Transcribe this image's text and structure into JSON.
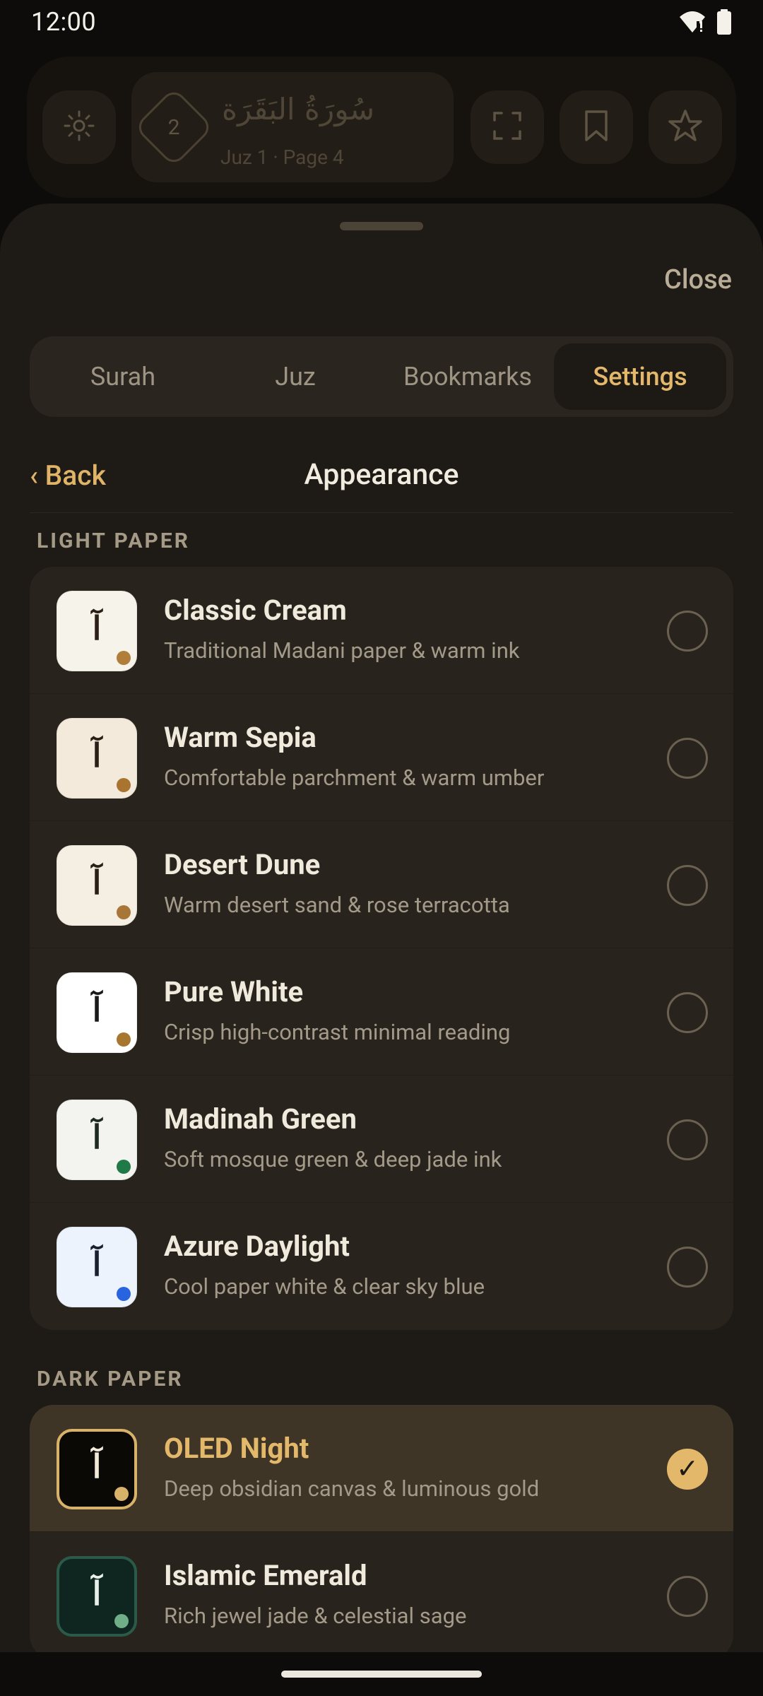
{
  "status_bar": {
    "time": "12:00"
  },
  "reader": {
    "surah_number": "2",
    "surah_name_arabic": "سُورَةُ البَقَرَة",
    "location": "Juz 1 · Page 4"
  },
  "sheet": {
    "close_label": "Close",
    "tabs": [
      {
        "label": "Surah",
        "active": false
      },
      {
        "label": "Juz",
        "active": false
      },
      {
        "label": "Bookmarks",
        "active": false
      },
      {
        "label": "Settings",
        "active": true
      }
    ],
    "back_label": "‹ Back",
    "title": "Appearance",
    "swatch_glyph": "آ",
    "light_section": {
      "label": "LIGHT PAPER",
      "themes": [
        {
          "name": "Classic Cream",
          "description": "Traditional Madani paper & warm ink",
          "bg": "#f6f3ea",
          "ink": "#2a2017",
          "accent": "#b07d3a",
          "selected": false
        },
        {
          "name": "Warm Sepia",
          "description": "Comfortable parchment & warm umber",
          "bg": "#f3eadb",
          "ink": "#2a2017",
          "accent": "#a8742f",
          "selected": false
        },
        {
          "name": "Desert Dune",
          "description": "Warm desert sand & rose terracotta",
          "bg": "#f5efe3",
          "ink": "#2a2017",
          "accent": "#a87636",
          "selected": false
        },
        {
          "name": "Pure White",
          "description": "Crisp high-contrast minimal reading",
          "bg": "#ffffff",
          "ink": "#1a1a1a",
          "accent": "#a8772f",
          "selected": false
        },
        {
          "name": "Madinah Green",
          "description": "Soft mosque green & deep jade ink",
          "bg": "#f3f4ef",
          "ink": "#1c2a21",
          "accent": "#1f7a47",
          "selected": false
        },
        {
          "name": "Azure Daylight",
          "description": "Cool paper white & clear sky blue",
          "bg": "#edf3fd",
          "ink": "#1a2030",
          "accent": "#2864e0",
          "selected": false
        }
      ]
    },
    "dark_section": {
      "label": "DARK PAPER",
      "themes": [
        {
          "name": "OLED Night",
          "description": "Deep obsidian canvas & luminous gold",
          "bg": "#0b0906",
          "ink": "#f1ead8",
          "accent": "#d9b26a",
          "border": "#d9b26a",
          "selected": true
        },
        {
          "name": "Islamic Emerald",
          "description": "Rich jewel jade & celestial sage",
          "bg": "#0f2520",
          "ink": "#e8efe9",
          "accent": "#6fae86",
          "border": "#2c5a48",
          "selected": false
        }
      ]
    }
  }
}
